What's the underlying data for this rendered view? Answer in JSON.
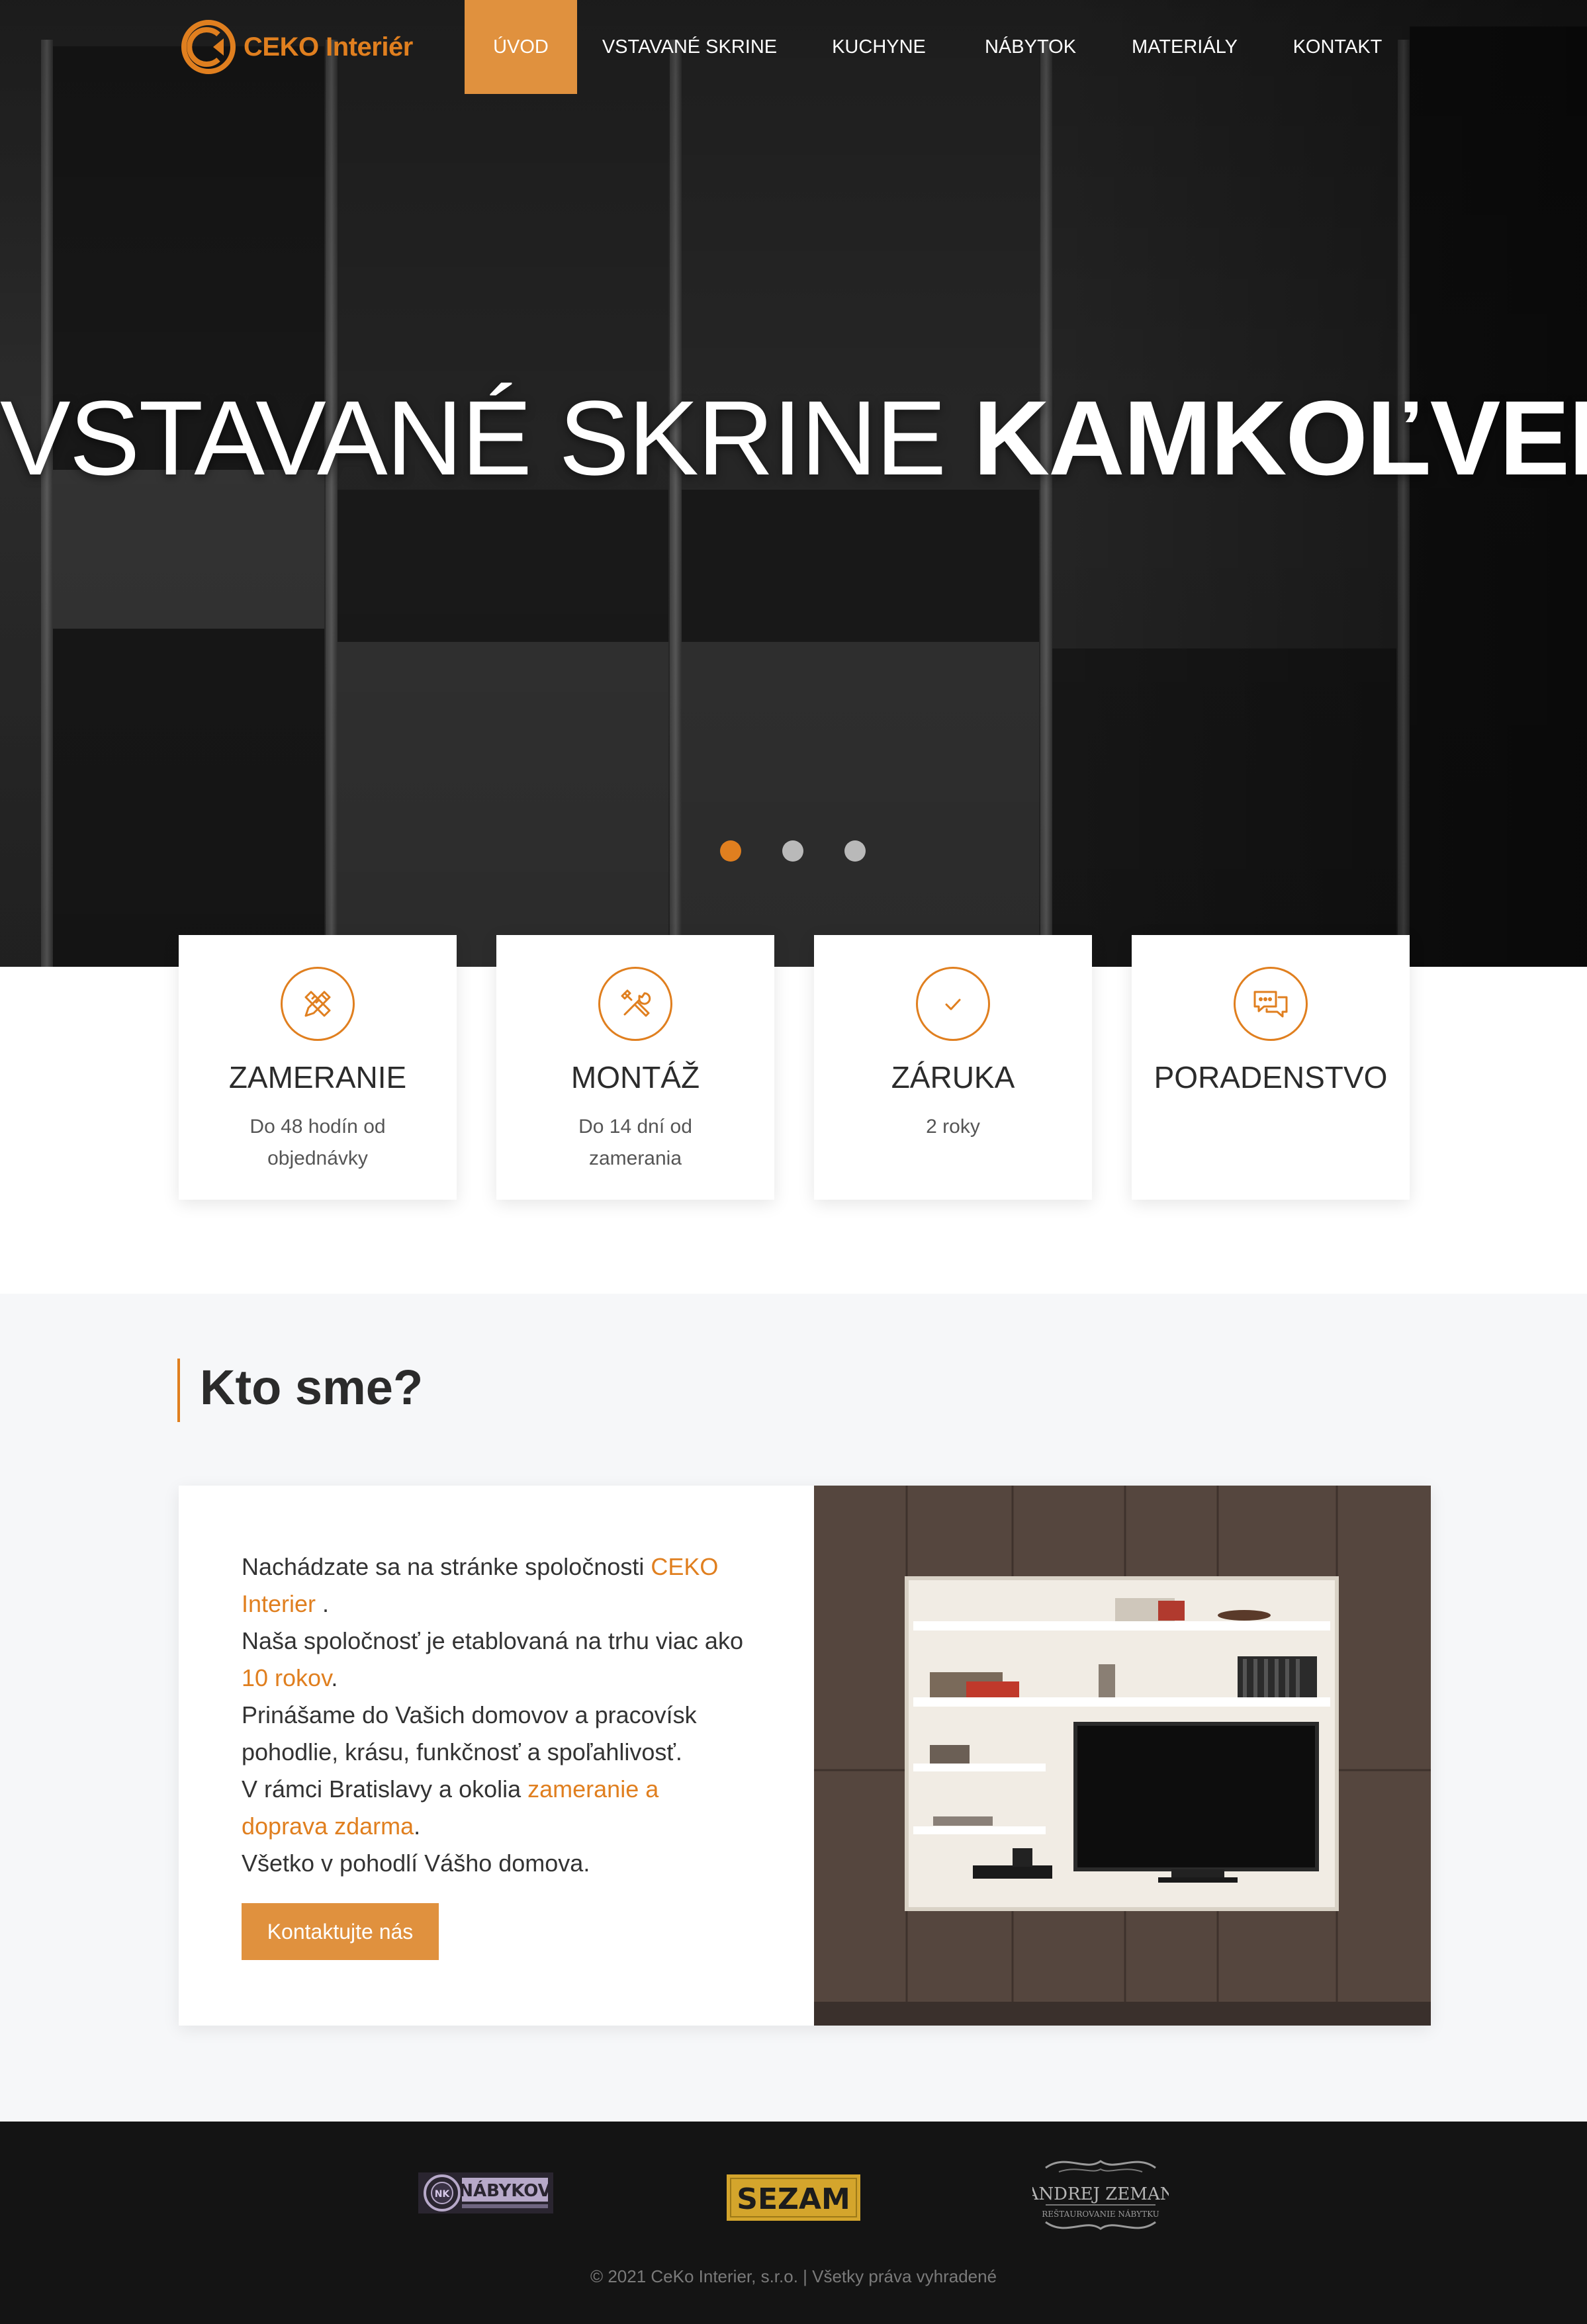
{
  "brand": {
    "name": "CEKO Interiér",
    "accent": "#e07f1f"
  },
  "nav": {
    "items": [
      {
        "label": "ÚVOD",
        "active": true
      },
      {
        "label": "VSTAVANÉ SKRINE",
        "active": false
      },
      {
        "label": "KUCHYNE",
        "active": false
      },
      {
        "label": "NÁBYTOK",
        "active": false
      },
      {
        "label": "MATERIÁLY",
        "active": false
      },
      {
        "label": "KONTAKT",
        "active": false
      }
    ]
  },
  "hero": {
    "title_light": "VSTAVANÉ SKRINE",
    "title_bold": "KAMKOĽVEK",
    "slides": 3,
    "active_slide": 1
  },
  "features": [
    {
      "icon": "pencil-ruler-icon",
      "title": "ZAMERANIE",
      "subtitle": "Do 48 hodín od objednávky"
    },
    {
      "icon": "tools-icon",
      "title": "MONTÁŽ",
      "subtitle": "Do 14 dní od zamerania"
    },
    {
      "icon": "checkmark-icon",
      "title": "ZÁRUKA",
      "subtitle": "2 roky"
    },
    {
      "icon": "chat-bubbles-icon",
      "title": "PORADENSTVO",
      "subtitle": ""
    }
  ],
  "about": {
    "heading": "Kto sme?",
    "p1_a": "Nachádzate sa na stránke spoločnosti ",
    "p1_b": "CEKO Interier",
    "p1_c": " .",
    "p2_a": "Naša spoločnosť je etablovaná na trhu viac ako ",
    "p2_b": "10 rokov",
    "p2_c": ".",
    "p3": "Prinášame do Vašich domovov a pracovísk pohodlie, krásu, funkčnosť a spoľahlivosť.",
    "p4_a": "V rámci Bratislavy a okolia ",
    "p4_b": "zameranie a doprava zdarma",
    "p4_c": ".",
    "p5": "Všetko v pohodlí Vášho domova.",
    "cta": "Kontaktujte nás"
  },
  "footer": {
    "partners": [
      "NÁBYKOV",
      "SEZAM",
      "ANDREJ ZEMAN",
      "REŠTAUROVANIE NÁBYTKU"
    ],
    "copyright": "© 2021 CeKo Interier, s.r.o. | Všetky práva vyhradené"
  }
}
